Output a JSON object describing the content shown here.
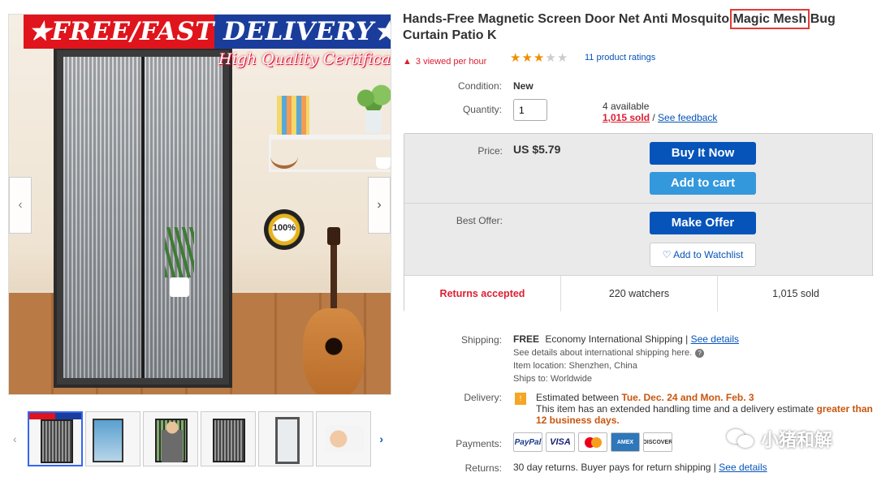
{
  "gallery": {
    "banner_text": "★FREE/FAST DELIVERY★",
    "cert_text": "High Quality Certification",
    "badge_text": "100%",
    "prev_arrow": "‹",
    "next_arrow": "›",
    "thumb_prev": "‹",
    "thumb_next": "›"
  },
  "product": {
    "title_before": "Hands-Free Magnetic Screen Door Net Anti Mosquito ",
    "title_highlight": "Magic Mesh",
    "title_after": " Bug Curtain Patio K",
    "viewed_text": "3 viewed per hour",
    "rating_stars": 3,
    "ratings_text": "11 product ratings"
  },
  "details": {
    "condition_label": "Condition:",
    "condition_value": "New",
    "quantity_label": "Quantity:",
    "quantity_value": "1",
    "available_text": "4 available",
    "sold_text": "1,015 sold",
    "separator": " / ",
    "feedback_link": "See feedback"
  },
  "buybox": {
    "price_label": "Price:",
    "price_value": "US $5.79",
    "buy_now": "Buy It Now",
    "add_to_cart": "Add to cart",
    "best_offer_label": "Best Offer:",
    "make_offer": "Make Offer",
    "watchlist": "Add to Watchlist",
    "stats": [
      "Returns accepted",
      "220 watchers",
      "1,015 sold"
    ]
  },
  "shipping": {
    "label": "Shipping:",
    "free": "FREE",
    "method": "Economy International Shipping",
    "pipe": " | ",
    "details_link": "See details",
    "note": "See details about international shipping here.",
    "location": "Item location:  Shenzhen, China",
    "ships_to": "Ships to:  Worldwide"
  },
  "delivery": {
    "label": "Delivery:",
    "prefix": "Estimated between ",
    "dates": "Tue. Dec. 24 and Mon. Feb. 3",
    "line2": "This item has an extended handling time and a delivery estimate ",
    "warning": "greater than 12 business days."
  },
  "payments": {
    "label": "Payments:",
    "logos": [
      "PayPal",
      "VISA",
      "",
      "AMEX",
      "DISCOVER"
    ]
  },
  "returns": {
    "label": "Returns:",
    "text": "30 day returns. Buyer pays for return shipping",
    "pipe": " | ",
    "details_link": "See details"
  },
  "watermark": {
    "text": "小猪和解"
  },
  "colors": {
    "link": "#0654ba",
    "buy_button": "#0654ba",
    "cart_button": "#3498dc",
    "alert_red": "#dd1e31",
    "star": "#f18e00"
  }
}
